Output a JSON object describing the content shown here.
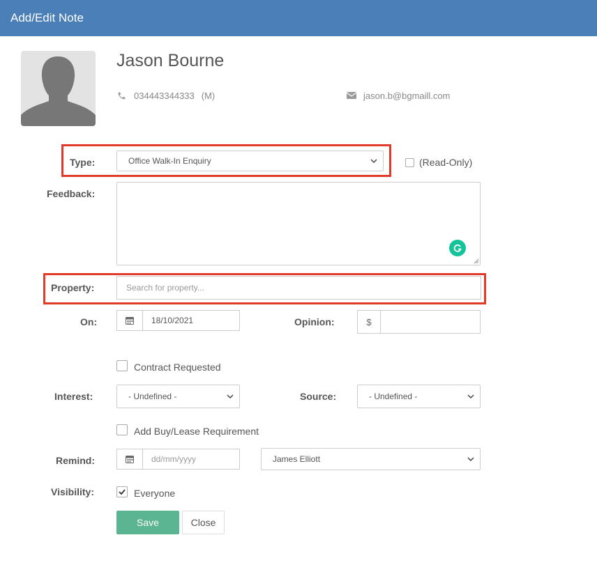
{
  "modal": {
    "title": "Add/Edit Note"
  },
  "contact": {
    "name": "Jason Bourne",
    "phone": "034443344333",
    "phone_type": "(M)",
    "email": "jason.b@bgmaill.com"
  },
  "form": {
    "type": {
      "label": "Type:",
      "value": "Office Walk-In Enquiry"
    },
    "read_only": {
      "label": "(Read-Only)",
      "checked": false
    },
    "feedback": {
      "label": "Feedback:",
      "value": ""
    },
    "property": {
      "label": "Property:",
      "placeholder": "Search for property..."
    },
    "on": {
      "label": "On:",
      "value": "18/10/2021"
    },
    "opinion": {
      "label": "Opinion:",
      "currency": "$",
      "value": ""
    },
    "contract_requested": {
      "label": "Contract Requested",
      "checked": false
    },
    "interest": {
      "label": "Interest:",
      "value": "- Undefined -"
    },
    "source": {
      "label": "Source:",
      "value": "- Undefined -"
    },
    "add_requirement": {
      "label": "Add Buy/Lease Requirement",
      "checked": false
    },
    "remind": {
      "label": "Remind:",
      "placeholder": "dd/mm/yyyy",
      "assignee": "James Elliott"
    },
    "visibility": {
      "label": "Visibility:",
      "option": "Everyone",
      "checked": true
    }
  },
  "buttons": {
    "save": "Save",
    "close": "Close"
  },
  "colors": {
    "header": "#4a7fb8",
    "save": "#5cb592",
    "highlight": "#e03a28",
    "grammarly": "#15c39a"
  },
  "icons": [
    "person-silhouette-icon",
    "phone-icon",
    "envelope-icon",
    "chevron-down-icon",
    "calendar-icon",
    "grammarly-icon",
    "check-icon"
  ]
}
